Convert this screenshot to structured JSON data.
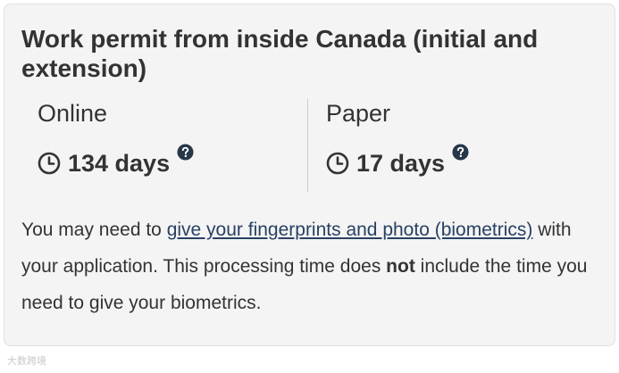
{
  "card": {
    "title": "Work permit from inside Canada (initial and extension)",
    "online": {
      "label": "Online",
      "time": "134 days",
      "clock_icon": "clock-icon",
      "help_icon": "question-circle-icon"
    },
    "paper": {
      "label": "Paper",
      "time": "17 days",
      "clock_icon": "clock-icon",
      "help_icon": "question-circle-icon"
    },
    "note": {
      "before_link": "You may need to ",
      "link_text": "give your fingerprints and photo (biometrics)",
      "after_link": " with your application. This processing time does ",
      "bold": "not",
      "end": " include the time you need to give your biometrics."
    }
  },
  "watermark": "大数跨境",
  "colors": {
    "card_background": "#f4f4f4",
    "text": "#333333",
    "link": "#284162",
    "icon_dark": "#333333",
    "help_icon": "#26374a"
  }
}
